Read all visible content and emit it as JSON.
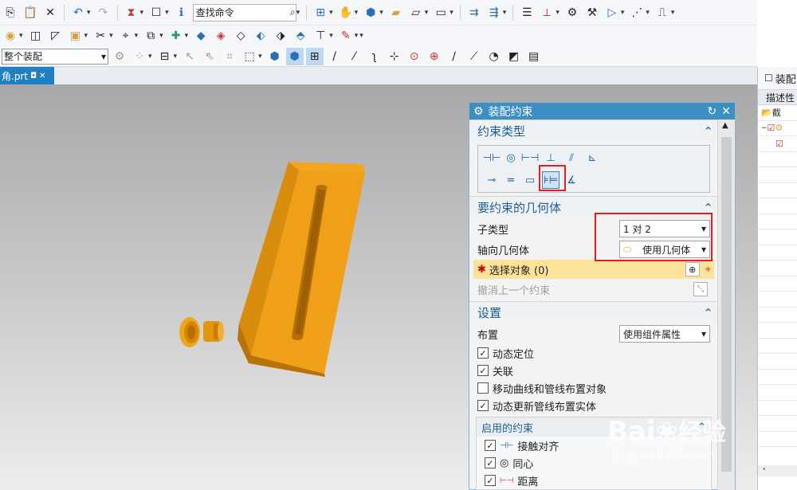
{
  "toolbar": {
    "command_search_value": "查找命令",
    "assembly_scope_value": "整个装配"
  },
  "tab": {
    "filename": "角.prt"
  },
  "right_panel": {
    "title": "装配",
    "column": "描述性",
    "row1": "截"
  },
  "dialog": {
    "title": "装配约束",
    "sec_type": "约束类型",
    "sec_geometry": "要约束的几何体",
    "subtype_label": "子类型",
    "subtype_value": "1 对 2",
    "axis_label": "轴向几何体",
    "axis_value": "使用几何体",
    "select_objects": "选择对象 (0)",
    "undo_last": "撤消上一个约束",
    "sec_settings": "设置",
    "layout_label": "布置",
    "layout_value": "使用组件属性",
    "checks": [
      {
        "label": "动态定位",
        "checked": true
      },
      {
        "label": "关联",
        "checked": true
      },
      {
        "label": "移动曲线和管线布置对象",
        "checked": false
      },
      {
        "label": "动态更新管线布置实体",
        "checked": true
      }
    ],
    "enabled_title": "启用的约束",
    "enabled": [
      {
        "label": "接触对齐",
        "checked": true
      },
      {
        "label": "同心",
        "checked": true
      },
      {
        "label": "距离",
        "checked": true
      }
    ]
  },
  "watermark": {
    "brand": "Bai",
    "brand2": "经验",
    "url": "jingyan.baidu.com"
  },
  "colors": {
    "accent": "#3d8ec1",
    "part": "#e89a10",
    "highlight": "#e02020",
    "select": "#fde299"
  }
}
